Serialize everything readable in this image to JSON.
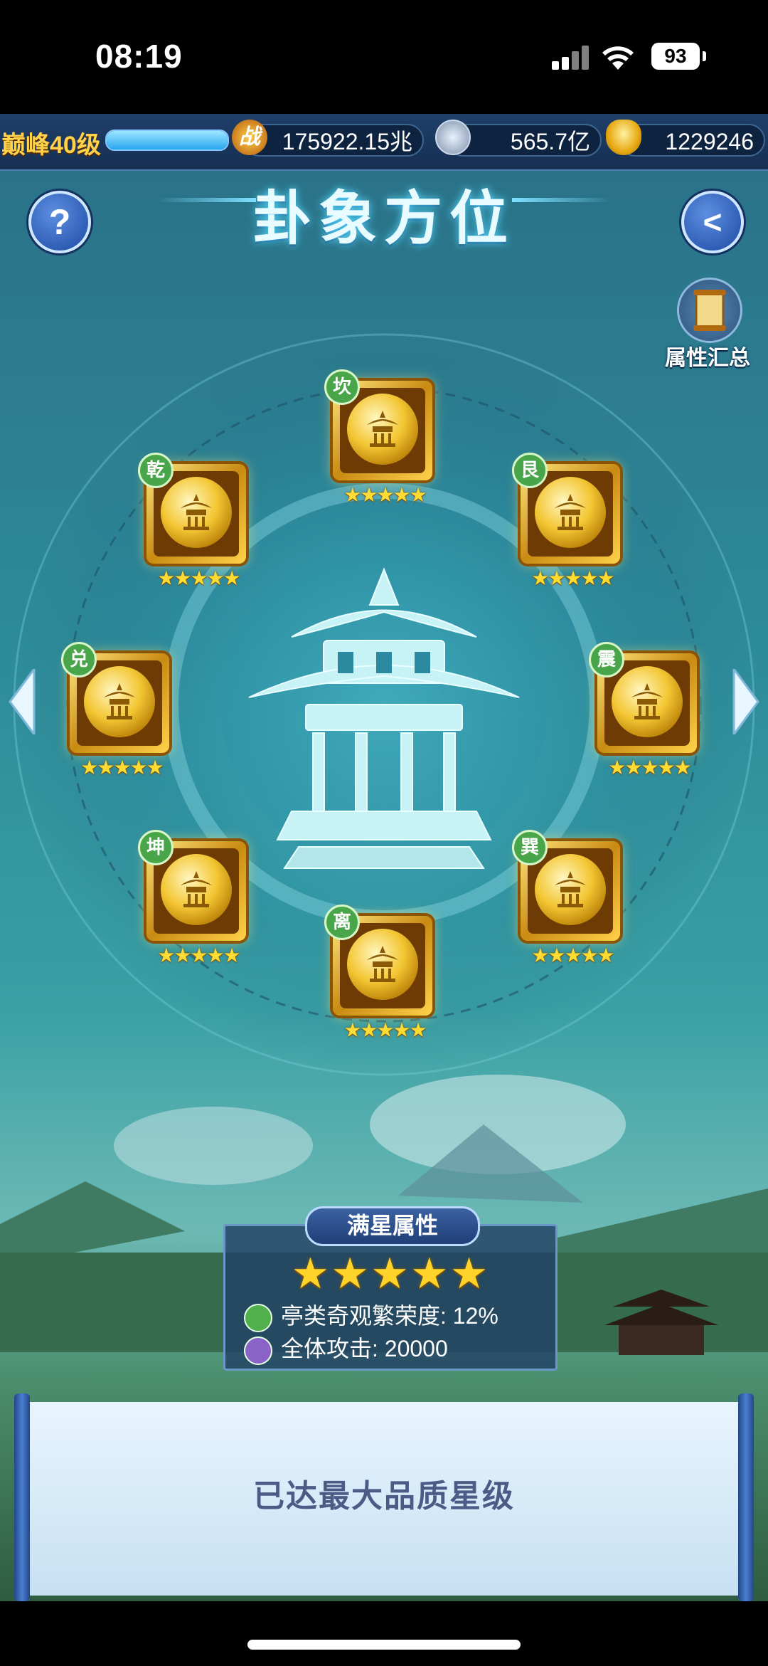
{
  "status_bar": {
    "time": "08:19",
    "battery": "93"
  },
  "resources": {
    "level": "巅峰40级",
    "level_progress": 1.0,
    "combat_power": "175922.15兆",
    "silver": "565.7亿",
    "gold": "1229246"
  },
  "header": {
    "title": "卦象方位"
  },
  "summary_button": {
    "label": "属性汇总"
  },
  "trigrams": [
    {
      "name": "坎",
      "stars": "★★★★★"
    },
    {
      "name": "艮",
      "stars": "★★★★★"
    },
    {
      "name": "震",
      "stars": "★★★★★"
    },
    {
      "name": "巽",
      "stars": "★★★★★"
    },
    {
      "name": "离",
      "stars": "★★★★★"
    },
    {
      "name": "坤",
      "stars": "★★★★★"
    },
    {
      "name": "兑",
      "stars": "★★★★★"
    },
    {
      "name": "乾",
      "stars": "★★★★★"
    }
  ],
  "full_star_panel": {
    "title": "满星属性",
    "stars": "★★★★★",
    "attributes": [
      {
        "icon": "leaf-icon",
        "text": "亭类奇观繁荣度: 12%"
      },
      {
        "icon": "sword-icon",
        "text": "全体攻击: 20000"
      }
    ]
  },
  "scroll": {
    "message": "已达最大品质星级"
  },
  "colors": {
    "gold": "#ffd24a",
    "panel_blue": "#224264",
    "badge_green": "#49a54a"
  }
}
